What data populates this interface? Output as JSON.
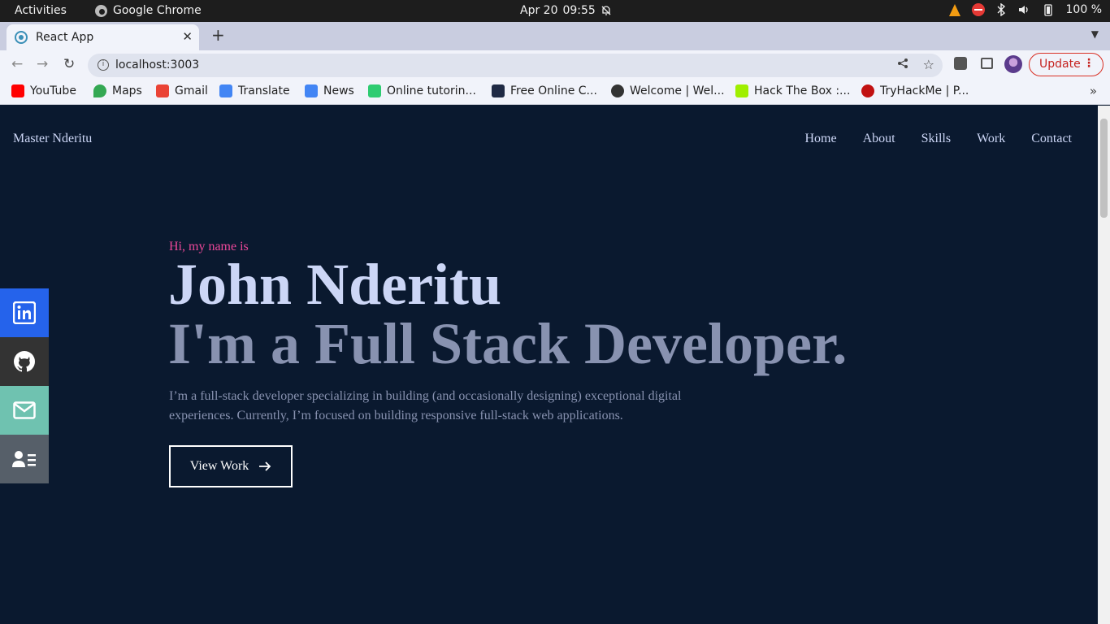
{
  "system_bar": {
    "activities": "Activities",
    "app_name": "Google Chrome",
    "date": "Apr 20",
    "time": "09:55",
    "battery": "100 %"
  },
  "browser": {
    "tab_title": "React App",
    "url": "localhost:3003",
    "update_label": "Update",
    "bookmarks": [
      {
        "label": "YouTube",
        "color": "#ff0000"
      },
      {
        "label": "Maps",
        "color": "#34a853"
      },
      {
        "label": "Gmail",
        "color": "#ea4335"
      },
      {
        "label": "Translate",
        "color": "#4285f4"
      },
      {
        "label": "News",
        "color": "#4285f4"
      },
      {
        "label": "Online tutorin...",
        "color": "#2ecc71"
      },
      {
        "label": "Free Online C...",
        "color": "#1f2a44"
      },
      {
        "label": "Welcome | Wel...",
        "color": "#333333"
      },
      {
        "label": "Hack The Box :...",
        "color": "#9fef00"
      },
      {
        "label": "TryHackMe | P...",
        "color": "#c11111"
      }
    ]
  },
  "site": {
    "brand": "Master Nderitu",
    "nav": [
      "Home",
      "About",
      "Skills",
      "Work",
      "Contact"
    ],
    "intro": "Hi, my name is",
    "name": "John Nderitu",
    "role": "I'm a Full Stack Developer.",
    "description": "I’m a full-stack developer specializing in building (and occasionally designing) exceptional digital experiences. Currently, I’m focused on building responsive full-stack web applications.",
    "cta_label": "View Work",
    "social": [
      {
        "name": "linkedin",
        "color": "#2563eb"
      },
      {
        "name": "github",
        "color": "#333333"
      },
      {
        "name": "email",
        "color": "#6fc2b0"
      },
      {
        "name": "resume",
        "color": "#565f69"
      }
    ]
  },
  "colors": {
    "background": "#0a192f",
    "accent": "#ec4899",
    "heading": "#ccd6f6",
    "muted": "#8892b0"
  }
}
